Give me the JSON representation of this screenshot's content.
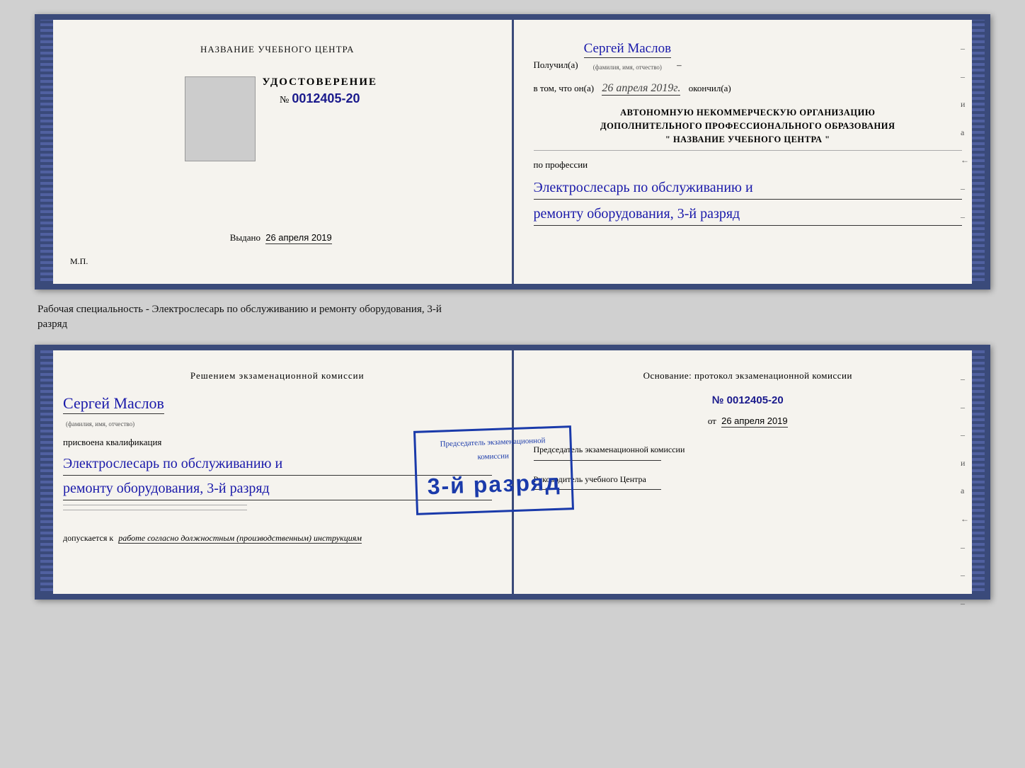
{
  "top_booklet": {
    "left": {
      "institution_title": "НАЗВАНИЕ УЧЕБНОГО ЦЕНТРА",
      "cert_word": "УДОСТОВЕРЕНИЕ",
      "cert_number_prefix": "№",
      "cert_number": "0012405-20",
      "issued_label": "Выдано",
      "issued_date": "26 апреля 2019",
      "mp_label": "М.П."
    },
    "right": {
      "received_label": "Получил(а)",
      "recipient_name": "Сергей Маслов",
      "name_caption": "(фамилия, имя, отчество)",
      "in_that_label": "в том, что он(а)",
      "date_value": "26 апреля 2019г.",
      "finished_label": "окончил(а)",
      "org_line1": "АВТОНОМНУЮ НЕКОММЕРЧЕСКУЮ ОРГАНИЗАЦИЮ",
      "org_line2": "ДОПОЛНИТЕЛЬНОГО ПРОФЕССИОНАЛЬНОГО ОБРАЗОВАНИЯ",
      "org_line3": "\"    НАЗВАНИЕ УЧЕБНОГО ЦЕНТРА    \"",
      "profession_label": "по профессии",
      "profession_line1": "Электрослесарь по обслуживанию и",
      "profession_line2": "ремонту оборудования, 3-й разряд"
    }
  },
  "between_label": {
    "text": "Рабочая специальность - Электрослесарь по обслуживанию и ремонту оборудования, 3-й",
    "text2": "разряд"
  },
  "bottom_booklet": {
    "left": {
      "commission_title": "Решением экзаменационной  комиссии",
      "person_name": "Сергей Маслов",
      "name_caption": "(фамилия, имя, отчество)",
      "assigned_label": "присвоена квалификация",
      "qualification_line1": "Электрослесарь по обслуживанию и",
      "qualification_line2": "ремонту оборудования, 3-й разряд",
      "allowed_label": "допускается к",
      "allowed_text": "работе согласно должностным (производственным) инструкциям"
    },
    "stamp": {
      "grade_label": "3-й разряд",
      "grade_big": "3-й разряд"
    },
    "right": {
      "basis_label": "Основание: протокол экзаменационной  комиссии",
      "number_prefix": "№",
      "protocol_number": "0012405-20",
      "from_label": "от",
      "from_date": "26 апреля 2019",
      "chairman_role": "Председатель экзаменационной комиссии",
      "head_role": "Руководитель учебного Центра",
      "right_marks": [
        "и",
        "а",
        "←",
        "–",
        "–",
        "–",
        "–"
      ]
    }
  }
}
